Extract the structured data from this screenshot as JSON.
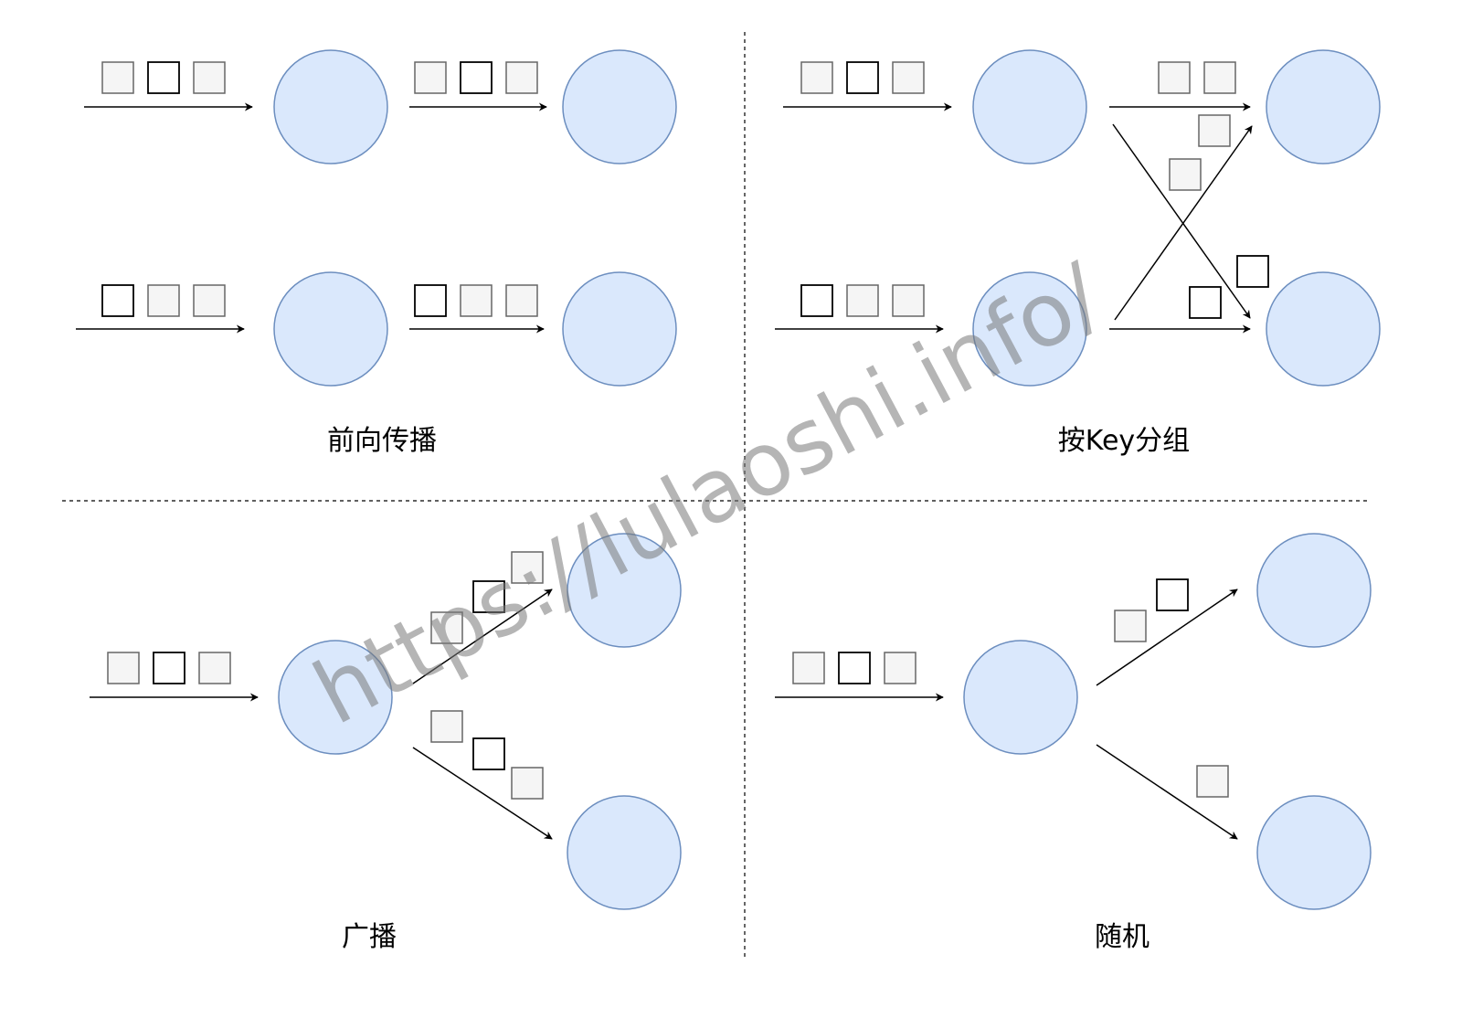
{
  "quadrants": {
    "forward": {
      "caption": "前向传播"
    },
    "key_group": {
      "caption": "按Key分组"
    },
    "broadcast": {
      "caption": "广播"
    },
    "random": {
      "caption": "随机"
    }
  },
  "watermark": {
    "text": "https://lulaoshi.info/"
  },
  "colors": {
    "node_fill": "#dae8fc",
    "node_stroke": "#6c8ebf",
    "box_gray": "#f5f5f5",
    "box_white": "#ffffff"
  }
}
